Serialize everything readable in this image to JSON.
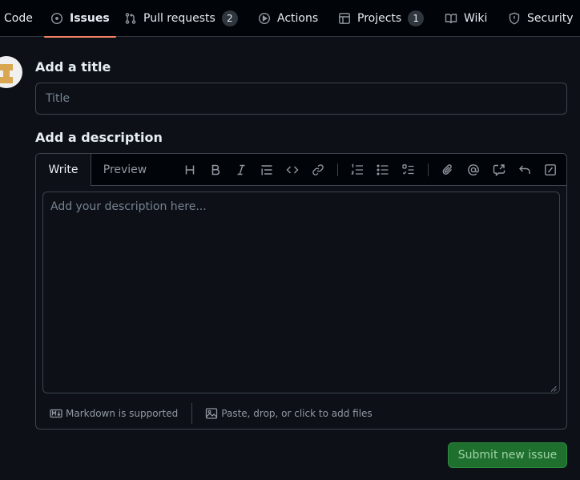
{
  "nav": {
    "tabs": [
      {
        "label": "Code",
        "icon": "code-icon"
      },
      {
        "label": "Issues",
        "icon": "issue-opened-icon",
        "active": true
      },
      {
        "label": "Pull requests",
        "icon": "git-pull-request-icon",
        "count": "2"
      },
      {
        "label": "Actions",
        "icon": "play-icon"
      },
      {
        "label": "Projects",
        "icon": "table-icon",
        "count": "1"
      },
      {
        "label": "Wiki",
        "icon": "book-icon"
      },
      {
        "label": "Security",
        "icon": "shield-icon"
      }
    ]
  },
  "form": {
    "title_label": "Add a title",
    "title_placeholder": "Title",
    "title_value": "",
    "description_label": "Add a description",
    "description_placeholder": "Add your description here...",
    "description_value": ""
  },
  "editor": {
    "tabs": {
      "write": "Write",
      "preview": "Preview"
    },
    "toolbar": [
      "heading-icon",
      "bold-icon",
      "italic-icon",
      "quote-icon",
      "code-icon",
      "link-icon",
      "ordered-list-icon",
      "unordered-list-icon",
      "task-list-icon",
      "attach-icon",
      "mention-icon",
      "reference-icon",
      "undo-icon",
      "slash-commands-icon"
    ],
    "footer": {
      "markdown": "Markdown is supported",
      "attach": "Paste, drop, or click to add files"
    }
  },
  "actions": {
    "submit": "Submit new issue"
  },
  "colors": {
    "accent_underline": "#f78166",
    "submit_bg": "#1f6f2f",
    "background": "#0d1117"
  }
}
